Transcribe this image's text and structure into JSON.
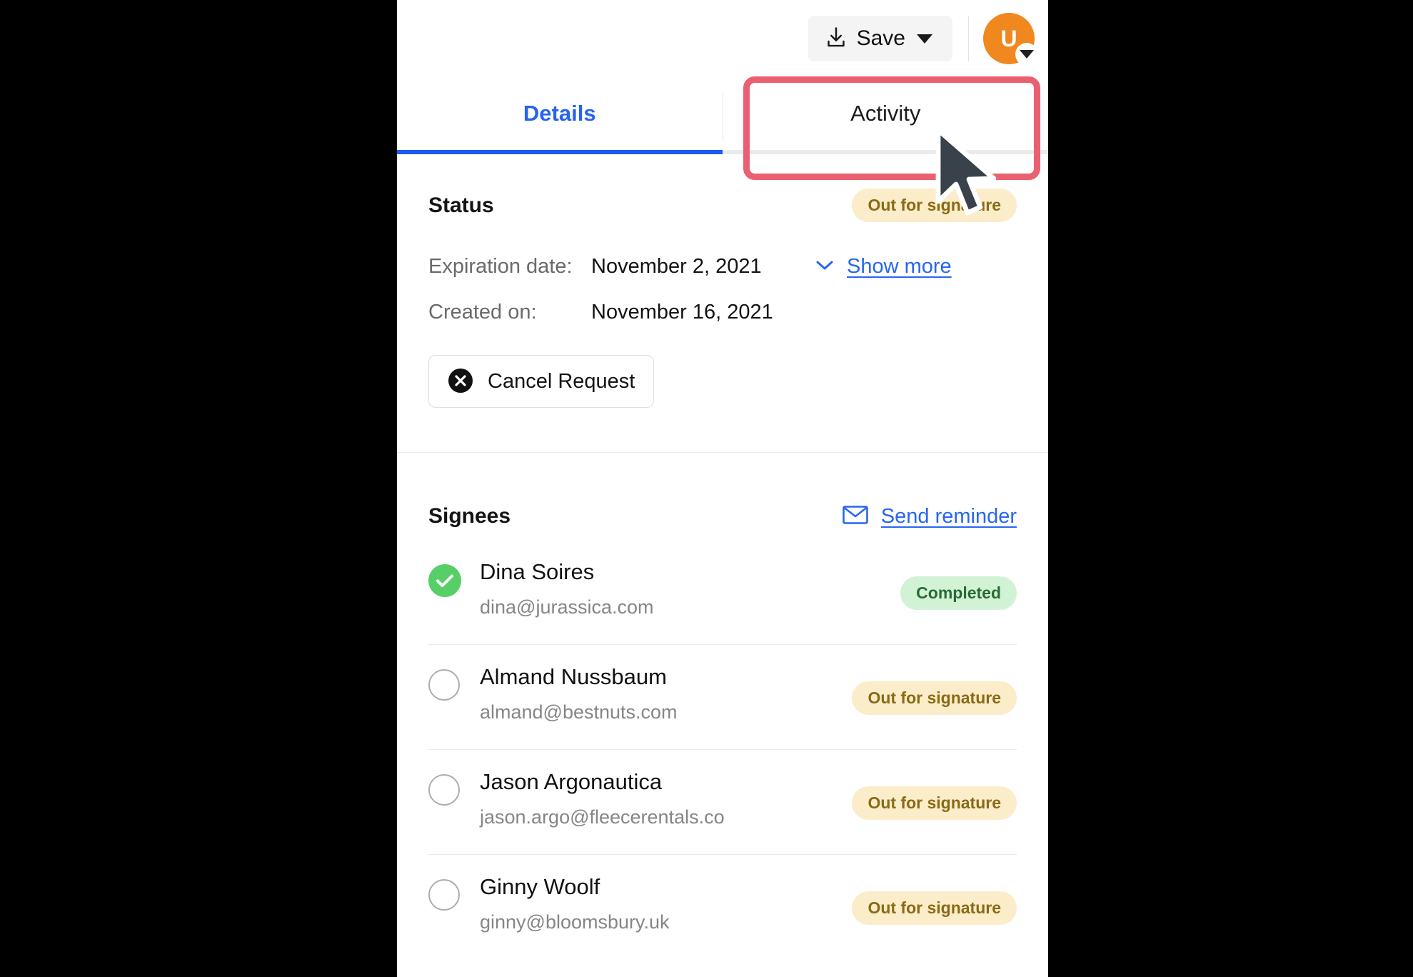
{
  "toolbar": {
    "save_label": "Save",
    "save_icon": "download-icon",
    "caret_icon": "chevron-down-icon",
    "avatar_initial": "U",
    "avatar_color": "#f0871f"
  },
  "tabs": [
    {
      "label": "Details",
      "active": true
    },
    {
      "label": "Activity",
      "active": false
    }
  ],
  "status": {
    "heading": "Status",
    "badge": "Out for signature",
    "rows": [
      {
        "label": "Expiration date:",
        "value": "November 2, 2021"
      },
      {
        "label": "Created on:",
        "value": "November 16, 2021"
      }
    ],
    "show_more_label": "Show more",
    "cancel_label": "Cancel Request",
    "cancel_icon": "x-circle-icon"
  },
  "signees": {
    "heading": "Signees",
    "send_reminder_label": "Send reminder",
    "send_reminder_icon": "envelope-icon",
    "rows": [
      {
        "name": "Dina Soires",
        "email": "dina@jurassica.com",
        "status": "Completed",
        "state": "completed"
      },
      {
        "name": "Almand Nussbaum",
        "email": "almand@bestnuts.com",
        "status": "Out for signature",
        "state": "pending"
      },
      {
        "name": "Jason Argonautica",
        "email": "jason.argo@fleecerentals.co",
        "status": "Out for signature",
        "state": "pending"
      },
      {
        "name": "Ginny Woolf",
        "email": "ginny@bloomsbury.uk",
        "status": "Out for signature",
        "state": "pending"
      }
    ]
  },
  "colors": {
    "accent_blue": "#1d5cf0",
    "link_blue": "#2766f0",
    "badge_warn_bg": "#fbedc9",
    "badge_warn_text": "#8a6a16",
    "badge_ok_bg": "#d2f2d6",
    "badge_ok_text": "#2a6a33",
    "check_green": "#56cf68",
    "highlight_red": "#ea6070"
  }
}
